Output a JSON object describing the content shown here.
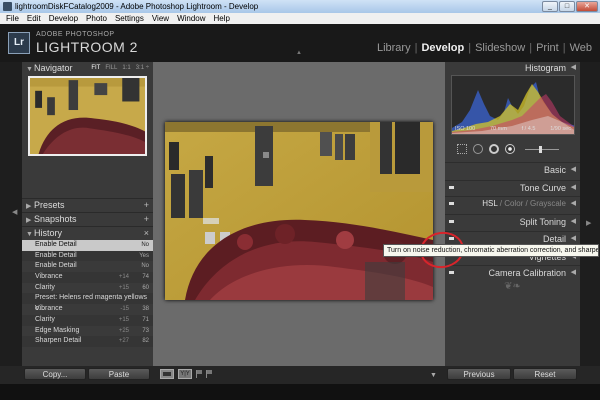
{
  "window": {
    "title": "lightroomDiskFCatalog2009 - Adobe Photoshop Lightroom - Develop",
    "buttons": [
      "_",
      "□",
      "✕"
    ]
  },
  "menu": [
    "File",
    "Edit",
    "Develop",
    "Photo",
    "Settings",
    "View",
    "Window",
    "Help"
  ],
  "brand": {
    "badge": "Lr",
    "top": "ADOBE PHOTOSHOP",
    "main": "LIGHTROOM 2"
  },
  "modules": [
    "Library",
    "Develop",
    "Slideshow",
    "Print",
    "Web"
  ],
  "active_module": "Develop",
  "left": {
    "navigator": {
      "title": "Navigator",
      "zoom": [
        "FIT",
        "FILL",
        "1:1",
        "3:1 ÷"
      ]
    },
    "presets": {
      "title": "Presets",
      "action": "+"
    },
    "snapshots": {
      "title": "Snapshots",
      "action": "+"
    },
    "history": {
      "title": "History",
      "action": "×",
      "rows": [
        {
          "label": "Enable Detail",
          "a": "",
          "b": "No",
          "selected": true
        },
        {
          "label": "Enable Detail",
          "a": "",
          "b": "Yes"
        },
        {
          "label": "Enable Detail",
          "a": "",
          "b": "No"
        },
        {
          "label": "Vibrance",
          "a": "+14",
          "b": "74"
        },
        {
          "label": "Clarity",
          "a": "+15",
          "b": "60"
        },
        {
          "label": "Preset: Helens red magenta yellows o...",
          "a": "",
          "b": ""
        },
        {
          "label": "Vibrance",
          "a": "-15",
          "b": "38"
        },
        {
          "label": "Clarity",
          "a": "+15",
          "b": "71"
        },
        {
          "label": "Edge Masking",
          "a": "+25",
          "b": "73"
        },
        {
          "label": "Sharpen Detail",
          "a": "+27",
          "b": "82"
        }
      ]
    },
    "buttons": {
      "copy": "Copy...",
      "paste": "Paste"
    }
  },
  "right": {
    "histogram": {
      "title": "Histogram",
      "iso": "ISO 100",
      "focal": "70 mm",
      "aperture": "f / 4.5",
      "shutter": "1/90 sec"
    },
    "sections": {
      "basic": "Basic",
      "tone_curve": "Tone Curve",
      "hsl": [
        "HSL",
        "Color",
        "Grayscale"
      ],
      "split_toning": "Split Toning",
      "detail": "Detail",
      "vignettes": "Vignettes",
      "camera_calibration": "Camera Calibration"
    },
    "buttons": {
      "previous": "Previous",
      "reset": "Reset"
    }
  },
  "tooltip": "Turn on noise reduction, chromatic aberration correction, and sharpening",
  "colors": {
    "accent_red": "#d8242b",
    "panel": "#3a3a3a",
    "background": "#1a1a1a"
  }
}
